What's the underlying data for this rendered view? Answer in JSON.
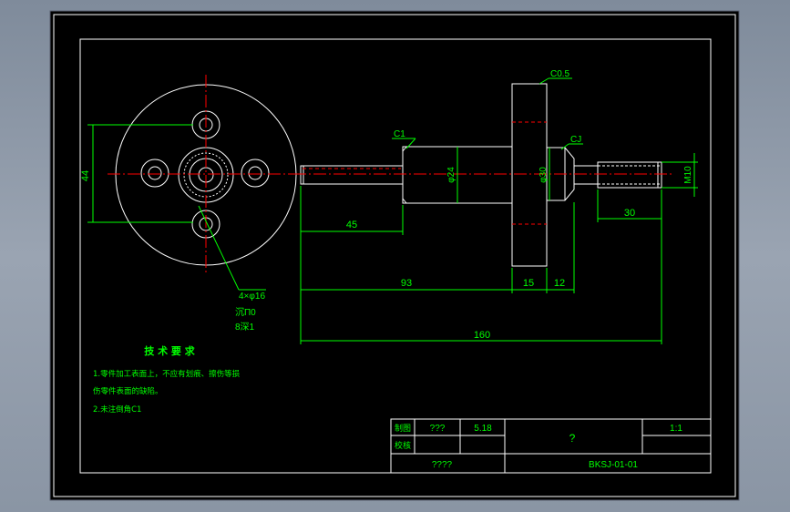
{
  "drawing": {
    "chamfer_top": "C0.5",
    "chamfer_left": "C1",
    "chamfer_right": "CJ",
    "dia_24": "φ24",
    "dia_30": "φ30",
    "thread": "M10",
    "dim_44": "44",
    "dim_45": "45",
    "dim_30": "30",
    "dim_93": "93",
    "dim_15": "15",
    "dim_12": "12",
    "dim_160": "160",
    "hole_note_1": "4×φ16",
    "hole_note_2": "沉П0",
    "hole_note_3": "8深1"
  },
  "requirements": {
    "title": "技 术 要 求",
    "line1": "1.零件加工表面上，不应有划痕、擦伤等损",
    "line2": "伤零件表面的缺陷。",
    "line3": "2.未注倒角C1"
  },
  "title_block": {
    "label_draw": "制图",
    "label_check": "校核",
    "drawer": "???",
    "date": "5.18",
    "part_name": "?",
    "scale": "1:1",
    "school": "????",
    "drawing_no": "BKSJ-01-01"
  },
  "colors": {
    "background": "#000000",
    "outline": "#ffffff",
    "dimension": "#00ff00",
    "centerline": "#ff0000",
    "text_yellow": "#ffff00"
  }
}
